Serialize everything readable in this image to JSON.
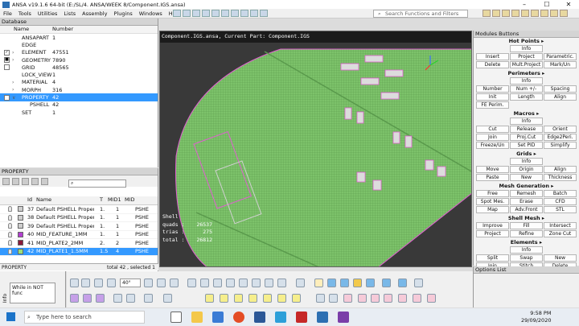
{
  "window": {
    "title": "ANSA v19.1.6 64-bit (E:/SL/4. ANSA/WEEK 8/Component.IGS.ansa)"
  },
  "menu": [
    "File",
    "Tools",
    "Utilities",
    "Lists",
    "Assembly",
    "Plugins",
    "Windows",
    "Help"
  ],
  "search": {
    "placeholder": "Search Functions and Filters"
  },
  "database": {
    "header": "Database",
    "col_name": "Name",
    "col_number": "Number",
    "rows": [
      {
        "name": "ANSAPART",
        "number": "1",
        "check": "none",
        "arrow": ""
      },
      {
        "name": "EDGE",
        "number": "",
        "check": "none",
        "arrow": ""
      },
      {
        "name": "ELEMENT",
        "number": "47551",
        "check": "checked",
        "arrow": ">"
      },
      {
        "name": "GEOMETRY",
        "number": "7890",
        "check": "partial",
        "arrow": ">"
      },
      {
        "name": "GRID",
        "number": "48565",
        "check": "empty",
        "arrow": ""
      },
      {
        "name": "LOCK_VIEW",
        "number": "1",
        "check": "none",
        "arrow": ""
      },
      {
        "name": "MATERIAL",
        "number": "4",
        "check": "none",
        "arrow": ">"
      },
      {
        "name": "MORPH",
        "number": "316",
        "check": "none",
        "arrow": ">"
      },
      {
        "name": "PROPERTY",
        "number": "42",
        "check": "empty",
        "arrow": "v",
        "selected": true
      },
      {
        "name": "PSHELL",
        "number": "42",
        "check": "none",
        "arrow": "",
        "indent": true
      },
      {
        "name": "SET",
        "number": "1",
        "check": "none",
        "arrow": ""
      }
    ]
  },
  "property": {
    "header": "PROPERTY",
    "cols": {
      "id": "Id",
      "name": "Name",
      "t": "T",
      "mid1": "MID1",
      "mid": "MID"
    },
    "rows": [
      {
        "id": "37",
        "name": "Default PSHELL Property",
        "t": "1.",
        "mid": "1",
        "type": "PSHE",
        "color": "#cfcfcf"
      },
      {
        "id": "38",
        "name": "Default PSHELL Property",
        "t": "1.",
        "mid": "1",
        "type": "PSHE",
        "color": "#cfcfcf"
      },
      {
        "id": "39",
        "name": "Default PSHELL Property",
        "t": "1.",
        "mid": "1",
        "type": "PSHE",
        "color": "#cfcfcf"
      },
      {
        "id": "40",
        "name": "MID_FEATURE_1MM",
        "t": "1.",
        "mid": "1",
        "type": "PSHE",
        "color": "#b23fd0"
      },
      {
        "id": "41",
        "name": "MID_PLATE2_2MM",
        "t": "2.",
        "mid": "2",
        "type": "PSHE",
        "color": "#8b1a3a"
      },
      {
        "id": "42",
        "name": "MID_PLATE1_1.5MM",
        "t": "1.5",
        "mid": "4",
        "type": "PSHE",
        "color": "#9be07a",
        "selected": true
      }
    ],
    "status_left": "PROPERTY",
    "status_right": "total 42 , selected 1"
  },
  "info": {
    "label": "Info",
    "text": "While in NOT func"
  },
  "viewport": {
    "header": "Component.IGS.ansa,  Current Part: Component.IGS",
    "stats_title": "Shell",
    "stats": [
      {
        "label": "quads :",
        "value": "26537"
      },
      {
        "label": "trias :",
        "value": "275"
      },
      {
        "label": "total :",
        "value": "26812"
      }
    ]
  },
  "modules": {
    "header": "Modules Buttons",
    "groups": [
      {
        "title": "Hot Points",
        "rows": [
          [
            "",
            "Info",
            ""
          ],
          [
            "Insert",
            "Project",
            "Parametric."
          ],
          [
            "Delete",
            "Mult.Project",
            "Mark/Un"
          ]
        ]
      },
      {
        "title": "Perimeters",
        "rows": [
          [
            "",
            "Info",
            ""
          ],
          [
            "Number",
            "Num +/-",
            "Spacing"
          ],
          [
            "Init",
            "Length",
            "Align"
          ],
          [
            "FE Perim.",
            "",
            ""
          ]
        ]
      },
      {
        "title": "Macros",
        "rows": [
          [
            "",
            "Info",
            ""
          ],
          [
            "Cut",
            "Release",
            "Orient"
          ],
          [
            "Join",
            "Proj.Cut",
            "Edge2Peri."
          ],
          [
            "Freeze/Un",
            "Set PID",
            "Simplify"
          ]
        ]
      },
      {
        "title": "Grids",
        "rows": [
          [
            "",
            "Info",
            ""
          ],
          [
            "Move",
            "Origin",
            "Align"
          ],
          [
            "Paste",
            "New",
            "Thickness"
          ]
        ]
      },
      {
        "title": "Mesh Generation",
        "rows": [
          [
            "Free",
            "Remesh",
            "Batch"
          ],
          [
            "Spot Mes.",
            "Erase",
            "CFD"
          ],
          [
            "Map",
            "Adv.Front",
            "STL"
          ]
        ]
      },
      {
        "title": "Shell Mesh",
        "rows": [
          [
            "Improve",
            "Fill",
            "Intersect"
          ],
          [
            "Project",
            "Refine",
            "Zone Cut"
          ]
        ]
      },
      {
        "title": "Elements",
        "rows": [
          [
            "",
            "Info",
            ""
          ],
          [
            "Split",
            "Swap",
            "New"
          ],
          [
            "Join",
            "Stitch",
            "Delete"
          ]
        ]
      }
    ]
  },
  "options": {
    "header": "Options List"
  },
  "toolbar": {
    "zoom": "40°"
  },
  "taskbar": {
    "search_placeholder": "Type here to search",
    "time": "9:58 PM",
    "date": "29/09/2020"
  },
  "colors": {
    "mesh": "#7cc26a",
    "mesh_line": "#5a9a4c",
    "feature": "#e060d0",
    "selection": "#3399ff"
  }
}
